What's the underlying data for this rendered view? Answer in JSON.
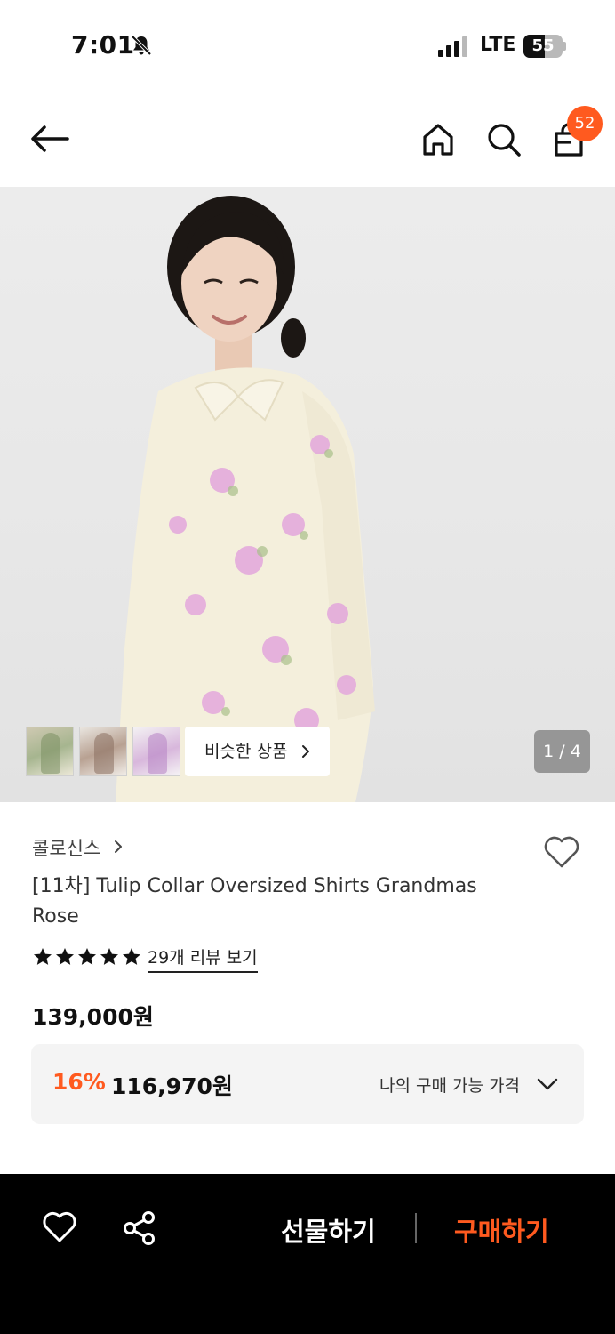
{
  "status_bar": {
    "time": "7:01",
    "network": "LTE",
    "battery_level": "55",
    "battery_fraction": 0.55,
    "icons": [
      "bell-slash-icon",
      "signal-icon",
      "battery-icon"
    ]
  },
  "header": {
    "icons": [
      "back-arrow-icon",
      "home-icon",
      "search-icon",
      "shopping-bag-icon"
    ],
    "cart_count": "52"
  },
  "gallery": {
    "thumbnails": [
      "thumbnail-1",
      "thumbnail-2",
      "thumbnail-3"
    ],
    "similar_label": "비슷한 상품",
    "page_indicator": "1 / 4"
  },
  "product": {
    "brand": "콜로신스",
    "title": "[11차] Tulip Collar Oversized Shirts Grandmas Rose",
    "rating_stars": 5,
    "review_link": "29개 리뷰 보기",
    "price": "139,000원",
    "discount_rate": "16%",
    "discount_price": "116,970원",
    "my_price_label": "나의 구매 가능 가격"
  },
  "bottom_bar": {
    "gift_label": "선물하기",
    "buy_label": "구매하기"
  },
  "colors": {
    "accent": "#ff5a1f",
    "bottom_bar_bg": "#000000",
    "discount_box_bg": "#f4f4f4"
  }
}
